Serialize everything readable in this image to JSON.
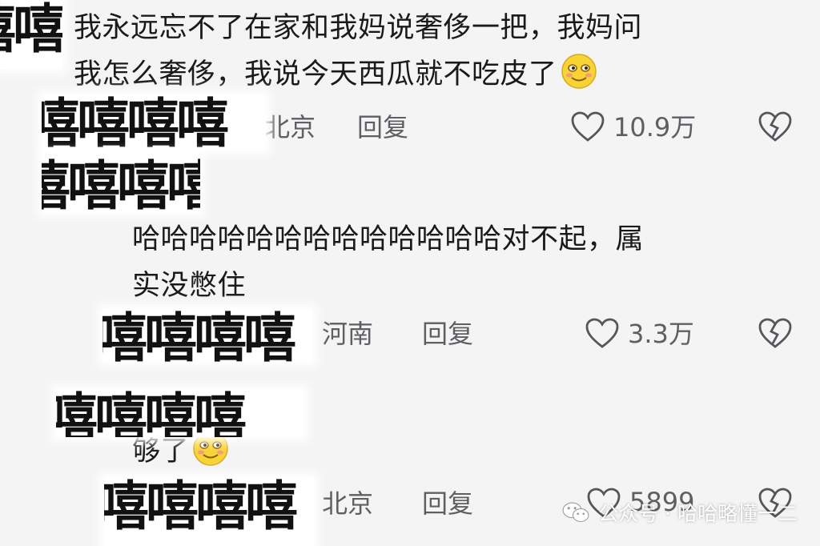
{
  "comments": [
    {
      "text_line1": "我永远忘不了在家和我妈说奢侈一把，我妈问",
      "text_line2": "我怎么奢侈，我说今天西瓜就不吃皮了",
      "emoji": "smiling-face-emoji",
      "location": "北京",
      "reply_label": "回复",
      "likes": "10.9万"
    },
    {
      "text_line1": "哈哈哈哈哈哈哈哈哈哈哈哈哈对不起，属",
      "text_line2": "实没憋住",
      "location": "河南",
      "reply_label": "回复",
      "likes": "3.3万"
    },
    {
      "text_line1": "够了",
      "emoji": "smiling-face-emoji",
      "location": "北京",
      "reply_label": "回复",
      "likes": "5899"
    }
  ],
  "censor_glyph": "嘻嘻嘻嘻",
  "watermark": {
    "icon": "wechat-icon",
    "text": "公众号 · 哈哈略懂一二"
  },
  "colors": {
    "background": "#f4f4f5",
    "meta_text": "#5f5f63",
    "body_text": "#1a1a1a"
  }
}
